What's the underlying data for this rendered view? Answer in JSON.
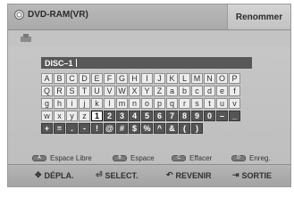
{
  "header": {
    "title": "DVD-RAM(VR)",
    "tab_label": "Renommer",
    "disc_icon": "disc-icon",
    "sub_icon": "settings-icon"
  },
  "name_field": {
    "value": "DISC–1"
  },
  "keyboard": {
    "rows": [
      [
        "A",
        "B",
        "C",
        "D",
        "E",
        "F",
        "G",
        "H",
        "I",
        "J",
        "K",
        "L",
        "M",
        "N",
        "O",
        "P"
      ],
      [
        "Q",
        "R",
        "S",
        "T",
        "U",
        "V",
        "W",
        "X",
        "Y",
        "Z",
        "a",
        "b",
        "c",
        "d",
        "e",
        "f"
      ],
      [
        "g",
        "h",
        "i",
        "j",
        "k",
        "l",
        "m",
        "n",
        "o",
        "p",
        "q",
        "r",
        "s",
        "t",
        "u",
        "v"
      ],
      [
        "w",
        "x",
        "y",
        "z",
        "1",
        "2",
        "3",
        "4",
        "5",
        "6",
        "7",
        "8",
        "9",
        "0",
        "–",
        "_"
      ],
      [
        "+",
        "=",
        ".",
        "-",
        "!",
        "@",
        "#",
        "$",
        "%",
        "^",
        "&",
        "(",
        ")"
      ]
    ],
    "selected": {
      "row": 3,
      "col": 4
    }
  },
  "options": [
    {
      "button": "A",
      "label": "Espace Libre"
    },
    {
      "button": "B",
      "label": "Espace"
    },
    {
      "button": "C",
      "label": "Effacer"
    },
    {
      "button": "D",
      "label": "Enreg."
    }
  ],
  "footer": {
    "move": "DÉPLA.",
    "select": "SELECT.",
    "back": "REVENIR",
    "exit": "SORTIE"
  }
}
